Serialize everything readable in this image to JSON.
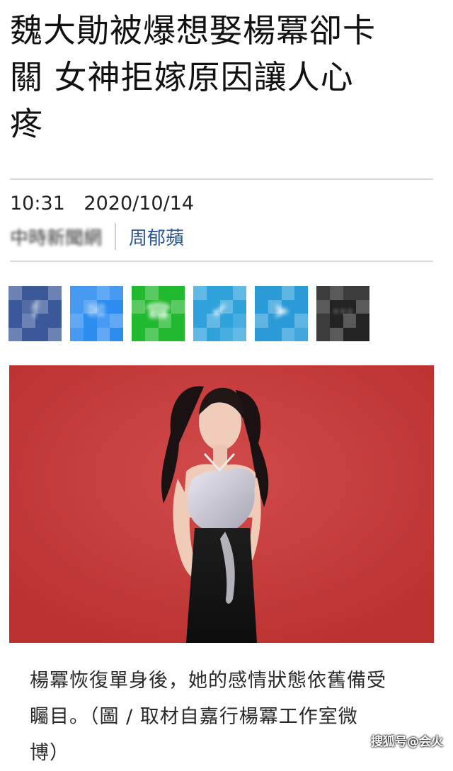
{
  "article": {
    "headline_lines": [
      "魏大勛被爆想娶楊冪卻卡",
      "關 女神拒嫁原因讓人心",
      "疼"
    ],
    "time": "10:31",
    "date": "2020/10/14",
    "source": "中時新聞網",
    "author": "周郁蘋"
  },
  "share_buttons": [
    {
      "name": "facebook-share",
      "icon": "facebook-icon",
      "color": "#3b5998",
      "glyph": "f"
    },
    {
      "name": "messenger-share",
      "icon": "messenger-icon",
      "color": "#2d8cf0",
      "glyph": "✉"
    },
    {
      "name": "line-share",
      "icon": "line-icon",
      "color": "#21b92d",
      "glyph": "☎"
    },
    {
      "name": "twitter-share",
      "icon": "twitter-icon",
      "color": "#2fa2dc",
      "glyph": "✔"
    },
    {
      "name": "telegram-share",
      "icon": "telegram-icon",
      "color": "#2b9bd8",
      "glyph": "➤"
    },
    {
      "name": "more-share",
      "icon": "more-icon",
      "color": "#222222",
      "glyph": "⋯"
    }
  ],
  "photo": {
    "background_color": "#c53a3c"
  },
  "caption_lines": [
    "楊冪恢復單身後，她的感情狀態依舊備受",
    "矚目。（圖 / 取材自嘉行楊冪工作室微",
    "博）"
  ],
  "watermark": "搜狐号@会火"
}
